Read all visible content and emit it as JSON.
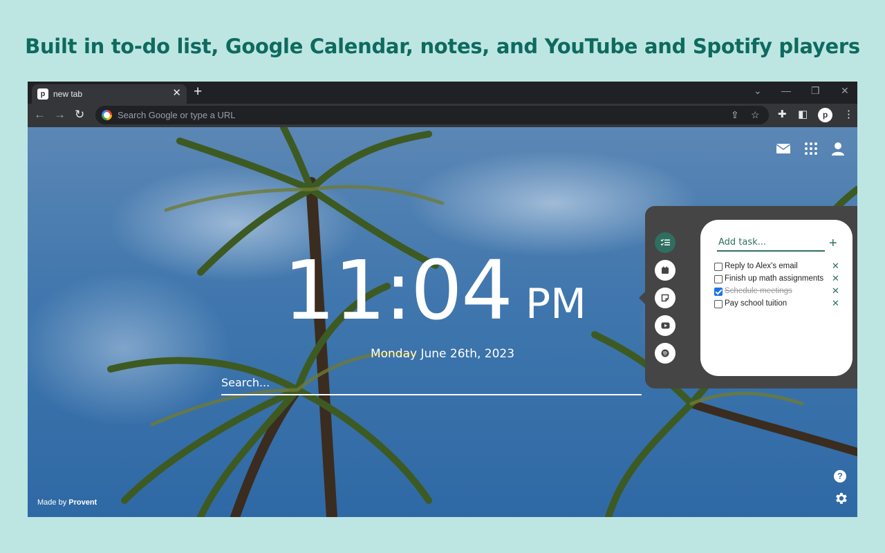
{
  "headline": "Built in to-do list, Google Calendar, notes, and YouTube and Spotify players",
  "browser": {
    "tab_title": "new tab",
    "tab_favicon_letter": "p",
    "profile_letter": "p",
    "omnibox_placeholder": "Search Google or type a URL",
    "icons": [
      "back-arrow-icon",
      "forward-arrow-icon",
      "reload-icon",
      "google-icon",
      "share-icon",
      "star-icon",
      "extensions-icon",
      "side-panel-icon",
      "menu-icon",
      "minimize-icon",
      "restore-icon",
      "close-icon",
      "chevron-down-icon"
    ]
  },
  "clock": {
    "time": "11:04",
    "ampm": "PM",
    "date": "Monday June 26th, 2023"
  },
  "search": {
    "placeholder": "Search..."
  },
  "todo": {
    "add_placeholder": "Add task...",
    "tasks": [
      {
        "label": "Reply to Alex's email",
        "done": false
      },
      {
        "label": "Finish up math assignments",
        "done": false
      },
      {
        "label": "Schedule meetings",
        "done": true
      },
      {
        "label": "Pay school tuition",
        "done": false
      }
    ]
  },
  "sidebar": {
    "items": [
      "todo-list-icon",
      "calendar-icon",
      "notes-icon",
      "youtube-icon",
      "spotify-icon"
    ],
    "active": "todo-list-icon"
  },
  "footer": {
    "credit_prefix": "Made by",
    "credit_brand": "Provent"
  },
  "colors": {
    "accent": "#2f6e60",
    "headline": "#0e6a5e",
    "background": "#bde6e3"
  }
}
